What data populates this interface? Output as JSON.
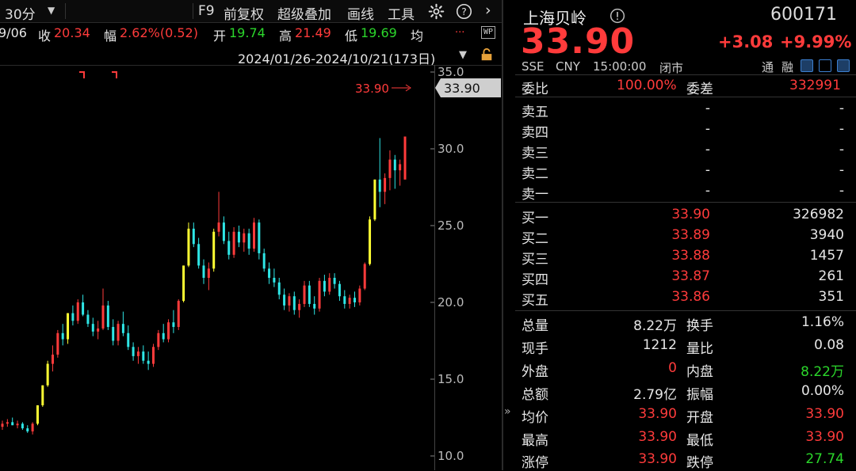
{
  "toolbar": {
    "period": "30分",
    "f9": "F9",
    "restore": "前复权",
    "overlay": "超级叠加",
    "draw": "画线",
    "tools": "工具"
  },
  "info_bar": {
    "date": "9/06",
    "close_label": "收",
    "close_value": "20.34",
    "amp_label": "幅",
    "amp_value": "2.62%(0.52)",
    "open_label": "开",
    "open_value": "19.74",
    "high_label": "高",
    "high_value": "21.49",
    "low_label": "低",
    "low_value": "19.69",
    "avg_label": "均",
    "more": "...",
    "wp_badge": "WP"
  },
  "range": {
    "text": "2024/01/26-2024/10/21(173日)"
  },
  "chart_data": {
    "type": "candlestick",
    "y_ticks": [
      "35.0",
      "30.0",
      "25.0",
      "20.0",
      "15.0",
      "10.0"
    ],
    "y_values": [
      35,
      30,
      25,
      20,
      15,
      10
    ],
    "last_price_label": "33.90",
    "last_price_tag": "33.90",
    "colors": {
      "up": "#ff3b3b",
      "down": "#2ee6e6",
      "limit": "#ffff33"
    },
    "candles": [
      [
        11.9,
        12.3,
        11.7,
        12.1
      ],
      [
        12.1,
        12.4,
        11.9,
        12.2
      ],
      [
        12.2,
        12.5,
        12.0,
        12.0
      ],
      [
        12.0,
        12.3,
        11.8,
        12.1
      ],
      [
        12.1,
        12.2,
        11.7,
        11.8
      ],
      [
        11.8,
        12.0,
        11.5,
        11.6
      ],
      [
        11.6,
        12.2,
        11.4,
        12.1
      ],
      [
        12.1,
        13.3,
        12.0,
        13.3
      ],
      [
        13.3,
        14.6,
        13.2,
        14.6
      ],
      [
        14.6,
        16.2,
        14.5,
        16.0
      ],
      [
        16.0,
        17.2,
        15.5,
        16.6
      ],
      [
        16.6,
        18.2,
        16.4,
        18.0
      ],
      [
        18.0,
        18.6,
        17.2,
        17.6
      ],
      [
        17.6,
        19.3,
        17.3,
        19.3
      ],
      [
        19.3,
        19.8,
        18.5,
        18.8
      ],
      [
        18.8,
        20.2,
        18.6,
        20.0
      ],
      [
        20.0,
        20.5,
        19.1,
        19.2
      ],
      [
        19.2,
        19.5,
        18.4,
        18.6
      ],
      [
        18.6,
        19.0,
        17.8,
        18.1
      ],
      [
        18.1,
        18.8,
        17.6,
        18.3
      ],
      [
        18.3,
        20.9,
        18.2,
        19.8
      ],
      [
        19.8,
        20.1,
        18.2,
        18.4
      ],
      [
        18.4,
        18.9,
        17.2,
        17.5
      ],
      [
        17.5,
        18.8,
        17.2,
        18.6
      ],
      [
        18.6,
        19.4,
        17.8,
        18.0
      ],
      [
        18.0,
        18.5,
        16.9,
        17.1
      ],
      [
        17.1,
        17.4,
        16.2,
        16.5
      ],
      [
        16.5,
        17.1,
        16.0,
        16.8
      ],
      [
        16.8,
        17.2,
        16.0,
        16.2
      ],
      [
        16.2,
        16.8,
        15.6,
        16.0
      ],
      [
        16.0,
        17.3,
        15.8,
        17.1
      ],
      [
        17.1,
        18.2,
        16.9,
        18.0
      ],
      [
        18.0,
        18.6,
        17.4,
        17.6
      ],
      [
        17.6,
        18.9,
        17.4,
        18.7
      ],
      [
        18.7,
        19.5,
        18.0,
        18.4
      ],
      [
        18.4,
        20.2,
        18.2,
        20.1
      ],
      [
        20.1,
        22.4,
        20.0,
        22.4
      ],
      [
        22.4,
        25.2,
        22.3,
        24.8
      ],
      [
        24.8,
        25.2,
        23.6,
        23.8
      ],
      [
        23.8,
        24.2,
        22.2,
        22.4
      ],
      [
        22.4,
        22.8,
        21.2,
        21.6
      ],
      [
        21.6,
        22.6,
        20.8,
        22.2
      ],
      [
        22.2,
        24.8,
        22.0,
        24.6
      ],
      [
        24.6,
        27.2,
        24.3,
        25.2
      ],
      [
        25.2,
        25.6,
        23.8,
        24.0
      ],
      [
        24.0,
        24.6,
        22.8,
        23.1
      ],
      [
        23.1,
        24.9,
        22.9,
        24.6
      ],
      [
        24.6,
        25.0,
        23.6,
        23.9
      ],
      [
        23.9,
        24.8,
        23.3,
        24.5
      ],
      [
        24.5,
        24.8,
        23.1,
        23.5
      ],
      [
        23.5,
        25.5,
        23.3,
        25.2
      ],
      [
        25.2,
        25.4,
        22.8,
        23.2
      ],
      [
        23.2,
        23.5,
        22.0,
        22.2
      ],
      [
        22.2,
        22.6,
        21.2,
        21.6
      ],
      [
        21.6,
        22.2,
        21.0,
        21.3
      ],
      [
        21.3,
        21.6,
        20.2,
        20.5
      ],
      [
        20.5,
        20.9,
        19.5,
        19.8
      ],
      [
        19.8,
        20.6,
        19.4,
        20.4
      ],
      [
        20.4,
        20.7,
        19.2,
        19.5
      ],
      [
        19.5,
        20.2,
        19.0,
        19.9
      ],
      [
        19.9,
        21.4,
        19.7,
        21.1
      ],
      [
        21.1,
        21.4,
        19.7,
        19.9
      ],
      [
        19.9,
        20.4,
        19.2,
        19.6
      ],
      [
        19.6,
        21.6,
        19.4,
        21.4
      ],
      [
        21.4,
        21.8,
        20.4,
        20.7
      ],
      [
        20.7,
        21.9,
        20.5,
        21.6
      ],
      [
        21.6,
        21.9,
        20.9,
        21.2
      ],
      [
        21.2,
        21.4,
        20.1,
        20.4
      ],
      [
        20.4,
        20.8,
        19.6,
        19.9
      ],
      [
        19.9,
        20.5,
        19.6,
        20.3
      ],
      [
        20.3,
        20.7,
        19.7,
        20.0
      ],
      [
        20.0,
        21.1,
        19.8,
        20.9
      ],
      [
        20.9,
        22.6,
        20.8,
        22.5
      ],
      [
        22.5,
        25.6,
        22.4,
        25.4
      ],
      [
        25.4,
        28.0,
        25.3,
        28.0
      ],
      [
        28.0,
        30.7,
        26.2,
        27.2
      ],
      [
        27.2,
        28.4,
        26.4,
        28.1
      ],
      [
        28.1,
        29.9,
        27.3,
        29.3
      ],
      [
        29.3,
        29.6,
        27.4,
        28.6
      ],
      [
        28.6,
        29.3,
        27.6,
        29.0
      ],
      [
        28.0,
        30.8,
        28.0,
        30.8
      ]
    ]
  },
  "quote": {
    "name": "上海贝岭",
    "code": "600171",
    "price": "33.90",
    "change": "+3.08",
    "change_pct": "+9.99%",
    "exchange": "SSE",
    "currency": "CNY",
    "time": "15:00:00",
    "status": "闭市",
    "tag1": "通",
    "tag2": "融"
  },
  "orderbook": {
    "ratio_label": "委比",
    "ratio_value": "100.00%",
    "diff_label": "委差",
    "diff_value": "332991",
    "asks": [
      {
        "label": "卖五",
        "price": "-",
        "vol": "-"
      },
      {
        "label": "卖四",
        "price": "-",
        "vol": "-"
      },
      {
        "label": "卖三",
        "price": "-",
        "vol": "-"
      },
      {
        "label": "卖二",
        "price": "-",
        "vol": "-"
      },
      {
        "label": "卖一",
        "price": "-",
        "vol": "-"
      }
    ],
    "bids": [
      {
        "label": "买一",
        "price": "33.90",
        "vol": "326982"
      },
      {
        "label": "买二",
        "price": "33.89",
        "vol": "3940"
      },
      {
        "label": "买三",
        "price": "33.88",
        "vol": "1457"
      },
      {
        "label": "买四",
        "price": "33.87",
        "vol": "261"
      },
      {
        "label": "买五",
        "price": "33.86",
        "vol": "351"
      }
    ]
  },
  "stats": {
    "vol_label": "总量",
    "vol_value": "8.22万",
    "turnover_label": "换手",
    "turnover_value": "1.16%",
    "cur_label": "现手",
    "cur_value": "1212",
    "ratio_label": "量比",
    "ratio_value": "0.08",
    "outer_label": "外盘",
    "outer_value": "0",
    "inner_label": "内盘",
    "inner_value": "8.22万",
    "amt_label": "总额",
    "amt_value": "2.79亿",
    "swing_label": "振幅",
    "swing_value": "0.00%",
    "avg_label": "均价",
    "avg_value": "33.90",
    "open_label": "开盘",
    "open_value": "33.90",
    "high_label": "最高",
    "high_value": "33.90",
    "low_label": "最低",
    "low_value": "33.90",
    "up_limit_label": "涨停",
    "up_limit_value": "33.90",
    "down_limit_label": "跌停",
    "down_limit_value": "27.74"
  },
  "divider": {
    "expand_glyph": "»"
  }
}
